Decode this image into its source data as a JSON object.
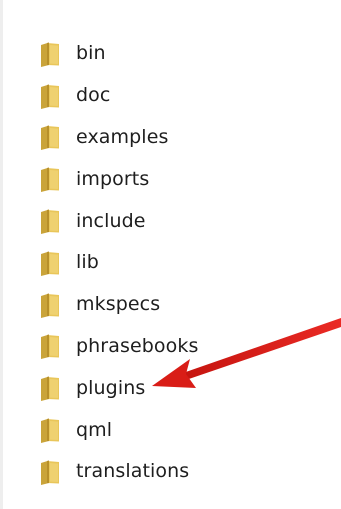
{
  "folders": [
    {
      "label": "bin",
      "icon": "folder-icon"
    },
    {
      "label": "doc",
      "icon": "folder-icon"
    },
    {
      "label": "examples",
      "icon": "folder-icon"
    },
    {
      "label": "imports",
      "icon": "folder-icon"
    },
    {
      "label": "include",
      "icon": "folder-icon"
    },
    {
      "label": "lib",
      "icon": "folder-icon"
    },
    {
      "label": "mkspecs",
      "icon": "folder-icon"
    },
    {
      "label": "phrasebooks",
      "icon": "folder-icon"
    },
    {
      "label": "plugins",
      "icon": "folder-icon"
    },
    {
      "label": "qml",
      "icon": "folder-icon"
    },
    {
      "label": "translations",
      "icon": "folder-icon"
    }
  ],
  "annotation": {
    "type": "arrow",
    "color": "#e0201b",
    "points_to": "plugins"
  },
  "colors": {
    "folder_front": "#e9c65a",
    "folder_back": "#caa43a",
    "text": "#1e1e1e"
  }
}
